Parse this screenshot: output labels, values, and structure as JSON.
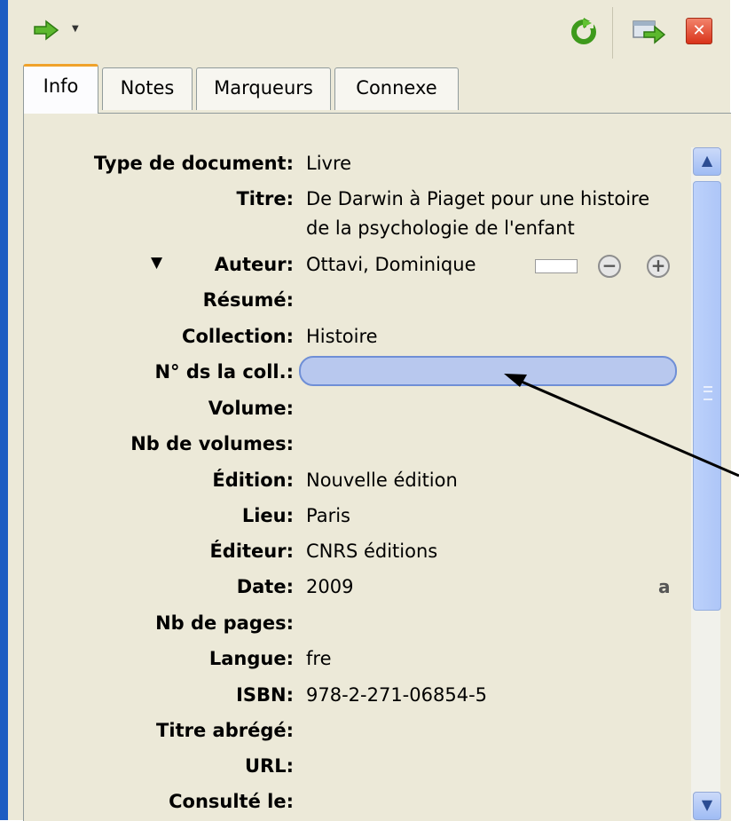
{
  "toolbar": {
    "locate_icon": "green-arrow-icon",
    "dropdown_icon": "chevron-down-icon",
    "sync_icon": "sync-icon",
    "open_icon": "open-pane-icon",
    "close_icon": "close-icon",
    "close_label": "✕",
    "accent_color": "#4aa520",
    "close_color": "#d9331a"
  },
  "tabs": [
    {
      "label": "Info",
      "active": true
    },
    {
      "label": "Notes",
      "active": false
    },
    {
      "label": "Marqueurs",
      "active": false
    },
    {
      "label": "Connexe",
      "active": false
    }
  ],
  "fields": {
    "type": {
      "label": "Type de document:",
      "value": "Livre"
    },
    "title": {
      "label": "Titre:",
      "value": "De Darwin à Piaget pour une histoire de la psychologie de l'enfant"
    },
    "author": {
      "label": "Auteur:",
      "value": "Ottavi, Dominique",
      "expander": "▼",
      "minus": "−",
      "plus": "+"
    },
    "abstract": {
      "label": "Résumé:",
      "value": ""
    },
    "collection": {
      "label": "Collection:",
      "value": "Histoire"
    },
    "coll_number": {
      "label": "N° ds la coll.:",
      "value": ""
    },
    "volume": {
      "label": "Volume:",
      "value": ""
    },
    "num_volumes": {
      "label": "Nb de volumes:",
      "value": ""
    },
    "edition": {
      "label": "Édition:",
      "value": "Nouvelle édition"
    },
    "place": {
      "label": "Lieu:",
      "value": "Paris"
    },
    "publisher": {
      "label": "Éditeur:",
      "value": "CNRS éditions"
    },
    "date": {
      "label": "Date:",
      "value": "2009",
      "suffix": "a"
    },
    "pages": {
      "label": "Nb de pages:",
      "value": ""
    },
    "language": {
      "label": "Langue:",
      "value": "fre"
    },
    "isbn": {
      "label": "ISBN:",
      "value": "978-2-271-06854-5"
    },
    "short_title": {
      "label": "Titre abrégé:",
      "value": ""
    },
    "url": {
      "label": "URL:",
      "value": ""
    },
    "accessed": {
      "label": "Consulté le:",
      "value": ""
    }
  },
  "scrollbar": {
    "up": "▲",
    "down": "▼"
  }
}
